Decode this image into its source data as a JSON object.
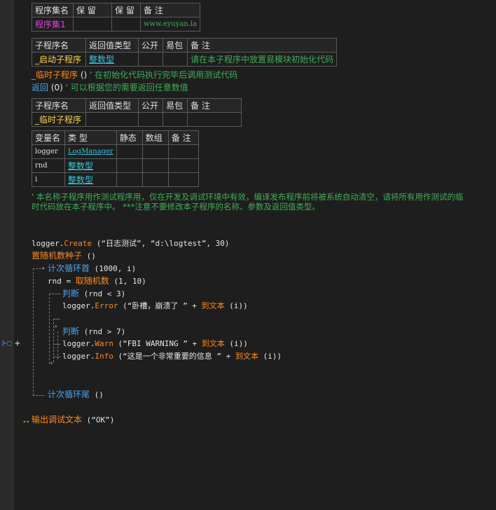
{
  "assembly_table": {
    "headers": [
      "程序集名",
      "保 留",
      "保 留",
      "备 注"
    ],
    "row": {
      "name": "程序集1",
      "r1": "",
      "r2": "",
      "note": "www.eyuyan.la"
    }
  },
  "sub1_table": {
    "headers": [
      "子程序名",
      "返回值类型",
      "公开",
      "易包",
      "备 注"
    ],
    "row": {
      "name": "_启动子程序",
      "type": "整数型",
      "public": "",
      "pkg": "",
      "note": "请在本子程序中放置易模块初始化代码"
    }
  },
  "line_call": {
    "name": "_临时子程序",
    "args": " () ",
    "comment": "' 在初始化代码执行完毕后调用测试代码"
  },
  "line_return": {
    "kw": "返回",
    "args": " (0) ",
    "comment": "' 可以根据您的需要返回任意数值"
  },
  "sub2_table": {
    "headers": [
      "子程序名",
      "返回值类型",
      "公开",
      "易包",
      "备 注"
    ],
    "row": {
      "name": "_临时子程序",
      "type": "",
      "public": "",
      "pkg": "",
      "note": ""
    }
  },
  "var_table": {
    "headers": [
      "变量名",
      "类 型",
      "静态",
      "数组",
      "备 注"
    ],
    "rows": [
      {
        "name": "logger",
        "type": "LogManager"
      },
      {
        "name": "rnd",
        "type": "整数型"
      },
      {
        "name": "i",
        "type": "整数型"
      }
    ]
  },
  "note_comment": {
    "line1": "' 本名称子程序用作测试程序用，仅在开发及调试环境中有效，编译发布程序前将被系统自动清空，请将所有用作测试的临",
    "line2": "时代码放在本子程序中。 ***注意不要修改本子程序的名称、参数及返回值类型。"
  },
  "code": {
    "l1": {
      "obj": "logger.",
      "method": "Create",
      "args": " (“日志测试”, “d:\\logtest”, 30)"
    },
    "l2": {
      "fn": "置随机数种子",
      "args": " ()"
    },
    "l3": {
      "kw": "计次循环首",
      "args": " (1000, i)"
    },
    "l4": {
      "pre": "rnd = ",
      "fn": "取随机数",
      "args": " (1, 10)"
    },
    "l5": {
      "kw": "判断",
      "args": " (rnd < 3)"
    },
    "l6": {
      "obj": "logger.",
      "method": "Error",
      "args1": " (“卧槽，崩溃了 ” + ",
      "fn": "到文本",
      "args2": " (i))"
    },
    "l7": {
      "kw": "判断",
      "args": " (rnd > 7)"
    },
    "l8": {
      "obj": "logger.",
      "method": "Warn",
      "args1": " (“FBI WARNING ” + ",
      "fn": "到文本",
      "args2": " (i))"
    },
    "l9": {
      "obj": "logger.",
      "method": "Info",
      "args1": " (“这是一个非常重要的信息 ” + ",
      "fn": "到文本",
      "args2": " (i))"
    },
    "l10": {
      "kw": "计次循环尾",
      "args": " ()"
    },
    "l11": {
      "fn": "输出调试文本",
      "args": " (“OK”)"
    }
  },
  "colors": {
    "bg": "#1e1e1e",
    "gutter": "#2b2b2b",
    "keyword": "#4aa4f0",
    "function": "#ff8a1a",
    "comment": "#3fae56",
    "type": "#36c5dc",
    "subname": "#ffd24a"
  }
}
